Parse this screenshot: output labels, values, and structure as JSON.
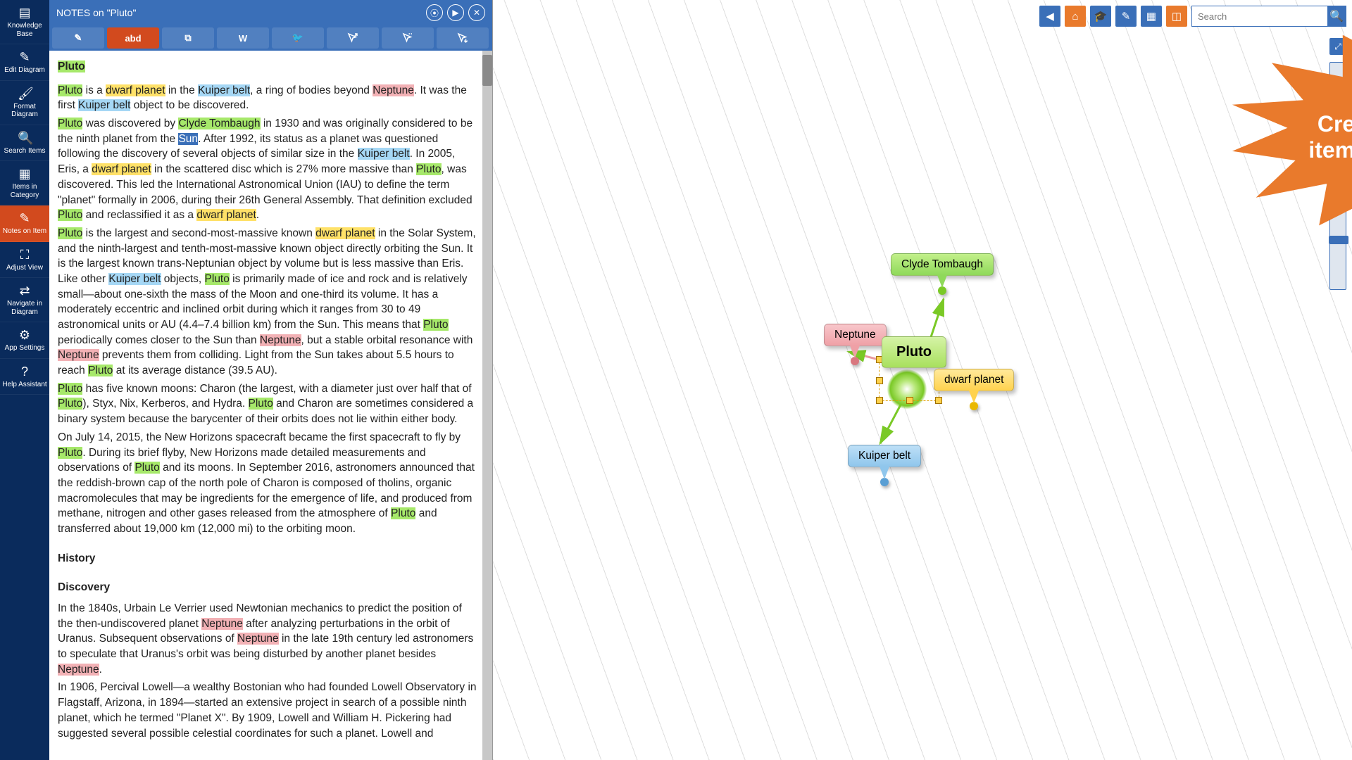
{
  "sidebar": {
    "items": [
      {
        "label": "Knowledge Base"
      },
      {
        "label": "Edit Diagram"
      },
      {
        "label": "Format Diagram"
      },
      {
        "label": "Search Items"
      },
      {
        "label": "Items in Category"
      },
      {
        "label": "Notes on Item"
      },
      {
        "label": "Adjust View"
      },
      {
        "label": "Navigate in Diagram"
      },
      {
        "label": "App Settings"
      },
      {
        "label": "Help Assistant"
      }
    ],
    "active_index": 5
  },
  "notes": {
    "header_title": "NOTES on \"Pluto\"",
    "toolbar_labels": {
      "abc": "abd",
      "w": "W"
    },
    "title": "Pluto",
    "history_heading": "History",
    "discovery_heading": "Discovery",
    "highlights": {
      "pluto": "Pluto",
      "dwarf_planet": "dwarf planet",
      "kuiper_belt": "Kuiper belt",
      "neptune": "Neptune",
      "clyde": "Clyde Tombaugh",
      "sun": "Sun"
    },
    "body_parts": {
      "p1a": " is a ",
      "p1b": " in the ",
      "p1c": ", a ring of bodies beyond ",
      "p1d": ". It was the first ",
      "p1e": " object to be discovered.",
      "p2a": " was discovered by ",
      "p2b": " in 1930 and was originally considered to be the ninth planet from the ",
      "p2c": ". After 1992, its status as a planet was questioned following the discovery of several objects of similar size in the ",
      "p2d": ". In 2005, Eris, a ",
      "p2e": " in the scattered disc which is 27% more massive than ",
      "p2f": ", was discovered. This led the International Astronomical Union (IAU) to define the term \"planet\" formally in 2006, during their 26th General Assembly. That definition excluded ",
      "p2g": " and reclassified it as a ",
      "p2h": ".",
      "p3a": " is the largest and second-most-massive known ",
      "p3b": " in the Solar System, and the ninth-largest and tenth-most-massive known object directly orbiting the Sun. It is the largest known trans-Neptunian object by volume but is less massive than Eris. Like other ",
      "p3c": " objects, ",
      "p3d": " is primarily made of ice and rock and is relatively small—about one-sixth the mass of the Moon and one-third its volume. It has a moderately eccentric and inclined orbit during which it ranges from 30 to 49 astronomical units or AU (4.4–7.4 billion km) from the Sun. This means that ",
      "p3e": " periodically comes closer to the Sun than ",
      "p3f": ", but a stable orbital resonance with ",
      "p3g": " prevents them from colliding. Light from the Sun takes about 5.5 hours to reach ",
      "p3h": " at its average distance (39.5 AU).",
      "p4a": " has five known moons: Charon (the largest, with a diameter just over half that of ",
      "p4b": "), Styx, Nix, Kerberos, and Hydra. ",
      "p4c": " and Charon are sometimes considered a binary system because the barycenter of their orbits does not lie within either body.",
      "p5a": "On July 14, 2015, the New Horizons spacecraft became the first spacecraft to fly by ",
      "p5b": ". During its brief flyby, New Horizons made detailed measurements and observations of ",
      "p5c": " and its moons. In September 2016, astronomers announced that the reddish-brown cap of the north pole of Charon is composed of tholins, organic macromolecules that may be ingredients for the emergence of life, and produced from methane, nitrogen and other gases released from the atmosphere of ",
      "p5d": " and transferred about 19,000 km (12,000 mi) to the orbiting moon.",
      "p6": "In the 1840s, Urbain Le Verrier used Newtonian mechanics to predict the position of the then-undiscovered planet ",
      "p6b": " after analyzing perturbations in the orbit of Uranus. Subsequent observations of ",
      "p6c": " in the late 19th century led astronomers to speculate that Uranus's orbit was being disturbed by another planet besides ",
      "p6d": ".",
      "p7": "In 1906, Percival Lowell—a wealthy Bostonian who had founded Lowell Observatory in Flagstaff, Arizona, in 1894—started an extensive project in search of a possible ninth planet, which he termed \"Planet X\". By 1909, Lowell and William H. Pickering had suggested several possible celestial coordinates for such a planet. Lowell and"
    }
  },
  "callout": {
    "line1": "Create new MindMap",
    "line2": "items by selecting text"
  },
  "mindmap": {
    "center": "Pluto",
    "nodes": {
      "clyde": "Clyde Tombaugh",
      "neptune": "Neptune",
      "dwarf": "dwarf planet",
      "kuiper": "Kuiper belt"
    }
  },
  "search": {
    "placeholder": "Search"
  }
}
